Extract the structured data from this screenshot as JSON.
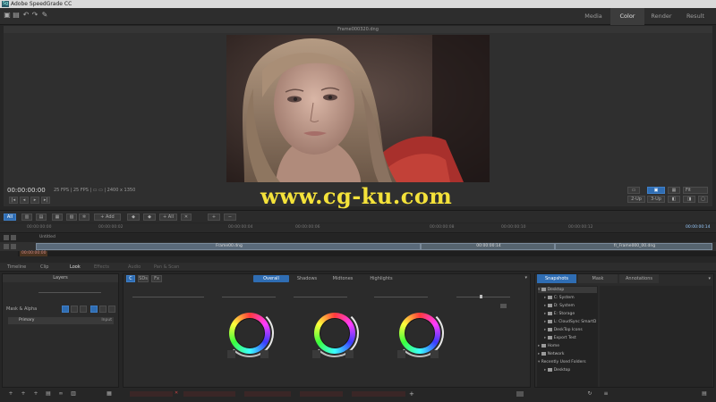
{
  "app": {
    "title": "Adobe SpeedGrade CC",
    "icon_text": "Sg"
  },
  "workspace_tabs": [
    "Media",
    "Color",
    "Render",
    "Result"
  ],
  "workspace_active": "Color",
  "viewer": {
    "file_title": "Frame000320.dng",
    "timecode": "00:00:00:00",
    "info": "25 FPS | 25 FPS | ▭ ▭ | 2400 x 1350",
    "right_chips": [
      "2-Up",
      "3-Up"
    ],
    "layout_value": "Fit"
  },
  "watermark": "www.cg-ku.com",
  "timeline": {
    "all_label": "All",
    "add_label": "+ Add",
    "add_all_label": "+ All",
    "ruler_start": "00:00:00:00",
    "ruler_end": "00:00:00:14",
    "ticks": [
      "00:00:00:02",
      "00:00:00:04",
      "00:00:00:06",
      "00:00:00:08",
      "00:00:00:10",
      "00:00:00:12"
    ],
    "track_name": "Untitled",
    "clip_label": "Frame00.dng",
    "clip_start": "00:00:00:00",
    "clip2_label": "00:00:00:14",
    "clip3_label": "fr_Frame000_00.dng"
  },
  "panel_tabs": [
    {
      "label": "Timeline",
      "state": "normal"
    },
    {
      "label": "Clip",
      "state": "normal"
    },
    {
      "label": "Look",
      "state": "active"
    },
    {
      "label": "Effects",
      "state": "dim"
    },
    {
      "label": "Audio",
      "state": "dim"
    },
    {
      "label": "Pan & Scan",
      "state": "dim"
    }
  ],
  "layers": {
    "title": "Layers",
    "mask_label": "Mask & Alpha",
    "primary_label": "Primary",
    "primary_option": "Input"
  },
  "wheels": {
    "tabs": [
      "Overall",
      "Shadows",
      "Midtones",
      "Highlights"
    ],
    "active_tab": "Overall",
    "left_chips": [
      "C",
      "SDs",
      "Fx"
    ]
  },
  "snapshots": {
    "tabs": [
      "Snapshots",
      "Mask",
      "Annotations"
    ],
    "active_tab": "Snapshots",
    "tree": [
      {
        "label": "Desktop",
        "indent": 0,
        "selected": true
      },
      {
        "label": "C: System",
        "indent": 1
      },
      {
        "label": "D: System",
        "indent": 1
      },
      {
        "label": "E: Storage",
        "indent": 1
      },
      {
        "label": "L: CloudSync SmartD",
        "indent": 1
      },
      {
        "label": "DeskTop Icons",
        "indent": 1
      },
      {
        "label": "Export Test",
        "indent": 1
      },
      {
        "label": "Home",
        "indent": 0
      },
      {
        "label": "Network",
        "indent": 0
      },
      {
        "label": "Recently Used Folders",
        "indent": 0
      },
      {
        "label": "Desktop",
        "indent": 1
      }
    ]
  },
  "colors": {
    "accent": "#2f6db3",
    "warning": "#c43a3a",
    "watermark": "#f4e23a"
  }
}
